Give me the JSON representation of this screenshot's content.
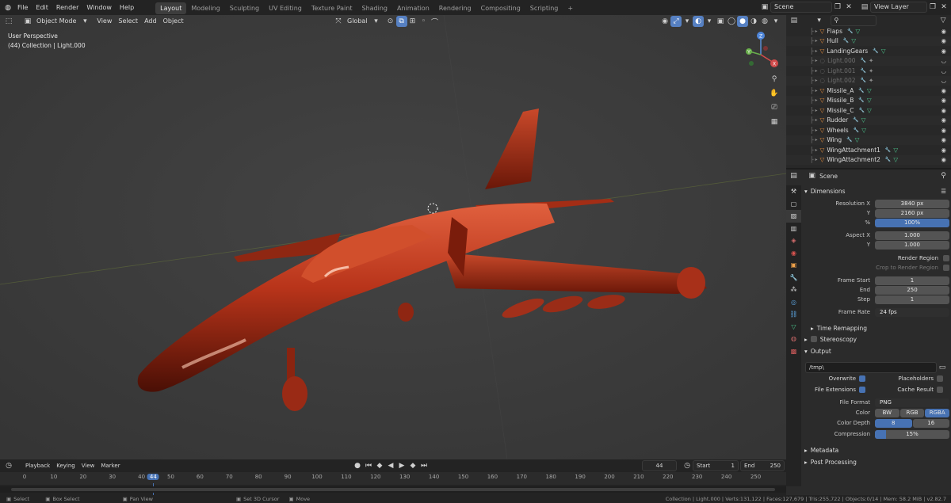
{
  "topbar": {
    "menus": [
      "File",
      "Edit",
      "Render",
      "Window",
      "Help"
    ],
    "workspaces": [
      "Layout",
      "Modeling",
      "Sculpting",
      "UV Editing",
      "Texture Paint",
      "Shading",
      "Animation",
      "Rendering",
      "Compositing",
      "Scripting"
    ],
    "active_workspace": "Layout",
    "add_tab": "+",
    "scene": "Scene",
    "view_layer": "View Layer"
  },
  "viewport": {
    "mode": "Object Mode",
    "menus": [
      "View",
      "Select",
      "Add",
      "Object"
    ],
    "orientation": "Global",
    "overlay_line1": "User Perspective",
    "overlay_line2": "(44) Collection | Light.000",
    "gizmo": {
      "x": "X",
      "y": "Y",
      "z": "Z"
    }
  },
  "outliner": {
    "items": [
      {
        "name": "Flaps",
        "dim": false
      },
      {
        "name": "Hull",
        "dim": false
      },
      {
        "name": "LandingGears",
        "dim": false
      },
      {
        "name": "Light.000",
        "dim": true
      },
      {
        "name": "Light.001",
        "dim": true
      },
      {
        "name": "Light.002",
        "dim": true
      },
      {
        "name": "Missile_A",
        "dim": false
      },
      {
        "name": "Missile_B",
        "dim": false
      },
      {
        "name": "Missile_C",
        "dim": false
      },
      {
        "name": "Rudder",
        "dim": false
      },
      {
        "name": "Wheels",
        "dim": false
      },
      {
        "name": "Wing",
        "dim": false
      },
      {
        "name": "WingAttachment1",
        "dim": false
      },
      {
        "name": "WingAttachment2",
        "dim": false
      }
    ]
  },
  "properties": {
    "scene_name": "Scene",
    "dimensions": {
      "title": "Dimensions",
      "resolution_x_label": "Resolution X",
      "resolution_x": "3840 px",
      "y_label": "Y",
      "resolution_y": "2160 px",
      "pct_label": "%",
      "resolution_pct": "100%",
      "aspect_x_label": "Aspect X",
      "aspect_x": "1.000",
      "aspect_y_label": "Y",
      "aspect_y": "1.000",
      "render_region": "Render Region",
      "crop": "Crop to Render Region",
      "frame_start_label": "Frame Start",
      "frame_start": "1",
      "end_label": "End",
      "frame_end": "250",
      "step_label": "Step",
      "frame_step": "1",
      "frame_rate_label": "Frame Rate",
      "frame_rate": "24 fps"
    },
    "time_remapping": "Time Remapping",
    "stereoscopy": "Stereoscopy",
    "output": {
      "title": "Output",
      "path": "/tmp\\",
      "overwrite": "Overwrite",
      "placeholders": "Placeholders",
      "file_extensions": "File Extensions",
      "cache_result": "Cache Result",
      "file_format_label": "File Format",
      "file_format": "PNG",
      "color_label": "Color",
      "color_options": [
        "BW",
        "RGB",
        "RGBA"
      ],
      "color_active": "RGBA",
      "color_depth_label": "Color Depth",
      "color_depth_options": [
        "8",
        "16"
      ],
      "compression_label": "Compression",
      "compression": "15%",
      "compression_fraction": 0.15
    },
    "metadata": "Metadata",
    "post_processing": "Post Processing"
  },
  "timeline": {
    "menus": [
      "Playback",
      "Keying",
      "View",
      "Marker"
    ],
    "current_frame": "44",
    "start_label": "Start",
    "start": "1",
    "end_label": "End",
    "end": "250",
    "ticks": [
      "0",
      "10",
      "20",
      "30",
      "40",
      "44",
      "50",
      "60",
      "70",
      "80",
      "90",
      "100",
      "110",
      "120",
      "130",
      "140",
      "150",
      "160",
      "170",
      "180",
      "190",
      "200",
      "210",
      "220",
      "230",
      "240",
      "250"
    ]
  },
  "statusbar": {
    "select": "Select",
    "box_select": "Box Select",
    "pan_view": "Pan View",
    "set_cursor": "Set 3D Cursor",
    "move": "Move",
    "stats": "Collection | Light.000 | Verts:131,122 | Faces:127,679 | Tris:255,722 | Objects:0/14 | Mem: 58.2 MiB | v2.82.7"
  },
  "colors": {
    "accent": "#4772b3",
    "plane": "#b8341a",
    "viewport_bg": "#3b3b3b"
  }
}
